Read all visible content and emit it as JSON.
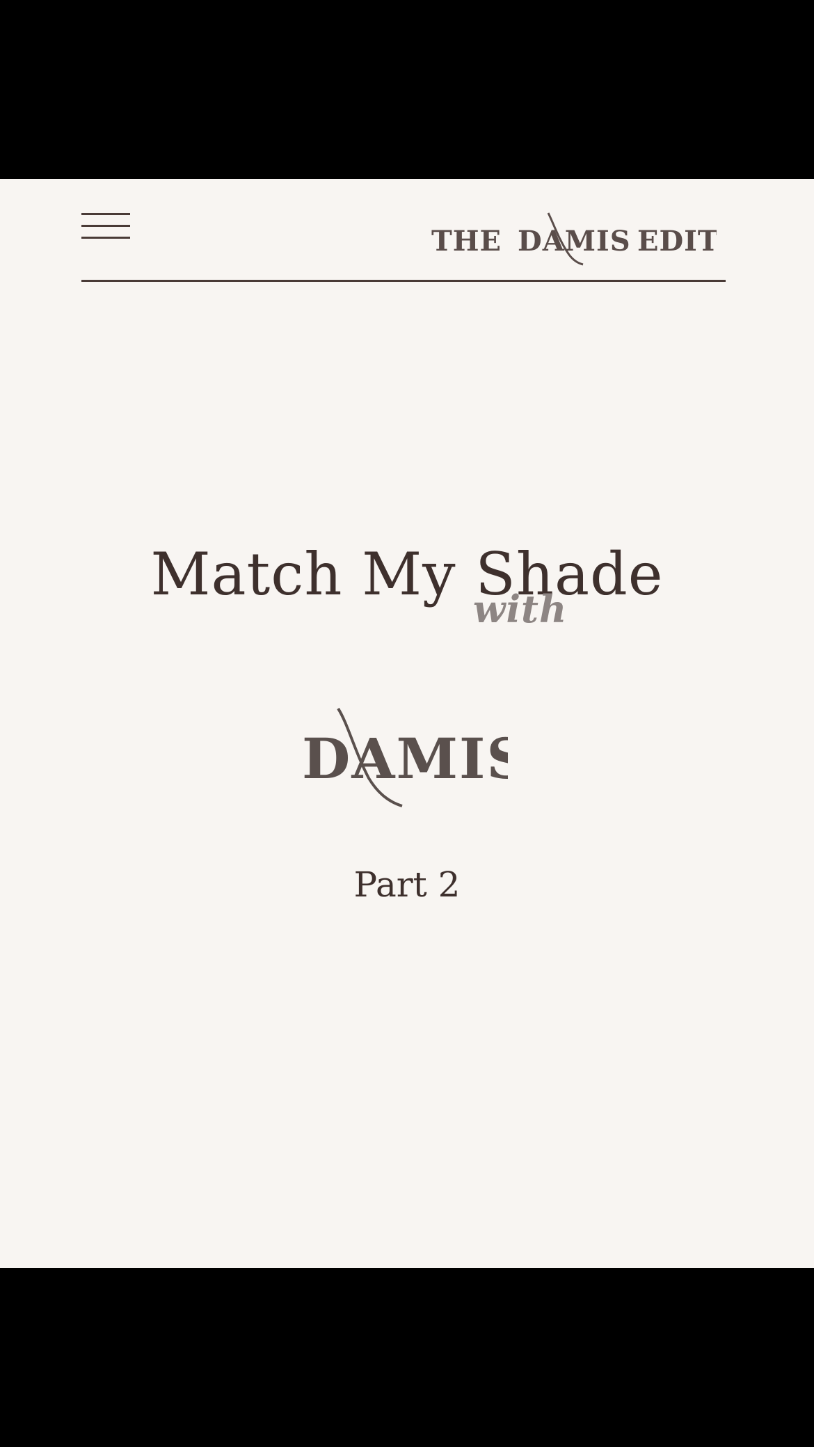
{
  "header": {
    "menu_icon": "hamburger-menu-icon",
    "brand": {
      "prefix": "THE",
      "name": "DAMIS",
      "suffix": "EDIT"
    }
  },
  "hero": {
    "title": "Match My Shade",
    "connector": "with",
    "logo_text": "DAMIS",
    "subtitle": "Part 2"
  },
  "colors": {
    "background": "#f8f5f2",
    "text": "#3e302d",
    "muted": "#8d8583",
    "letterbox": "#000000"
  }
}
